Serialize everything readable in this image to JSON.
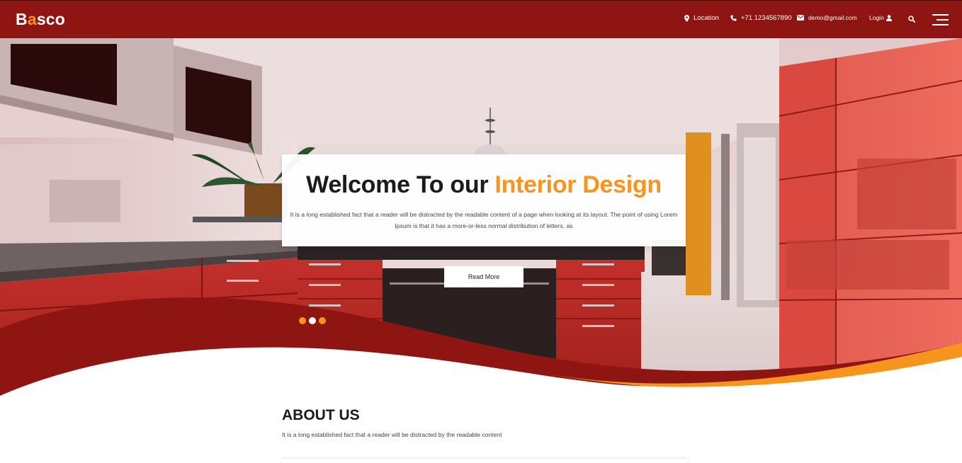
{
  "header": {
    "logo_first": "B",
    "logo_accent": "a",
    "logo_rest": "sco",
    "location": "Location",
    "phone": "+71 1234567890",
    "email": "demo@gmail.com",
    "login": "Login",
    "icons": [
      "map-marker-icon",
      "phone-icon",
      "envelope-icon",
      "user-icon",
      "search-icon",
      "hamburger-menu-icon"
    ]
  },
  "hero": {
    "title_main": "Welcome To our ",
    "title_highlight": "Interior Design",
    "description": "It is a long established fact that a reader will be distracted by the readable content of a page when looking at its layout. The point of using Lorem Ipsum is that it has a more-or-less normal distribution of letters, as",
    "button_label": "Read More",
    "slides": [
      {
        "active": false,
        "color": "#f7941d"
      },
      {
        "active": true,
        "color": "#ffffff"
      },
      {
        "active": false,
        "color": "#f7941d"
      }
    ]
  },
  "about": {
    "title": "ABOUT US",
    "text": "It is a long established fact that a reader will be distracted by the readable content"
  },
  "colors": {
    "brand": "#8e1511",
    "accent": "#f7941d",
    "cabinet": "#c9302c"
  }
}
